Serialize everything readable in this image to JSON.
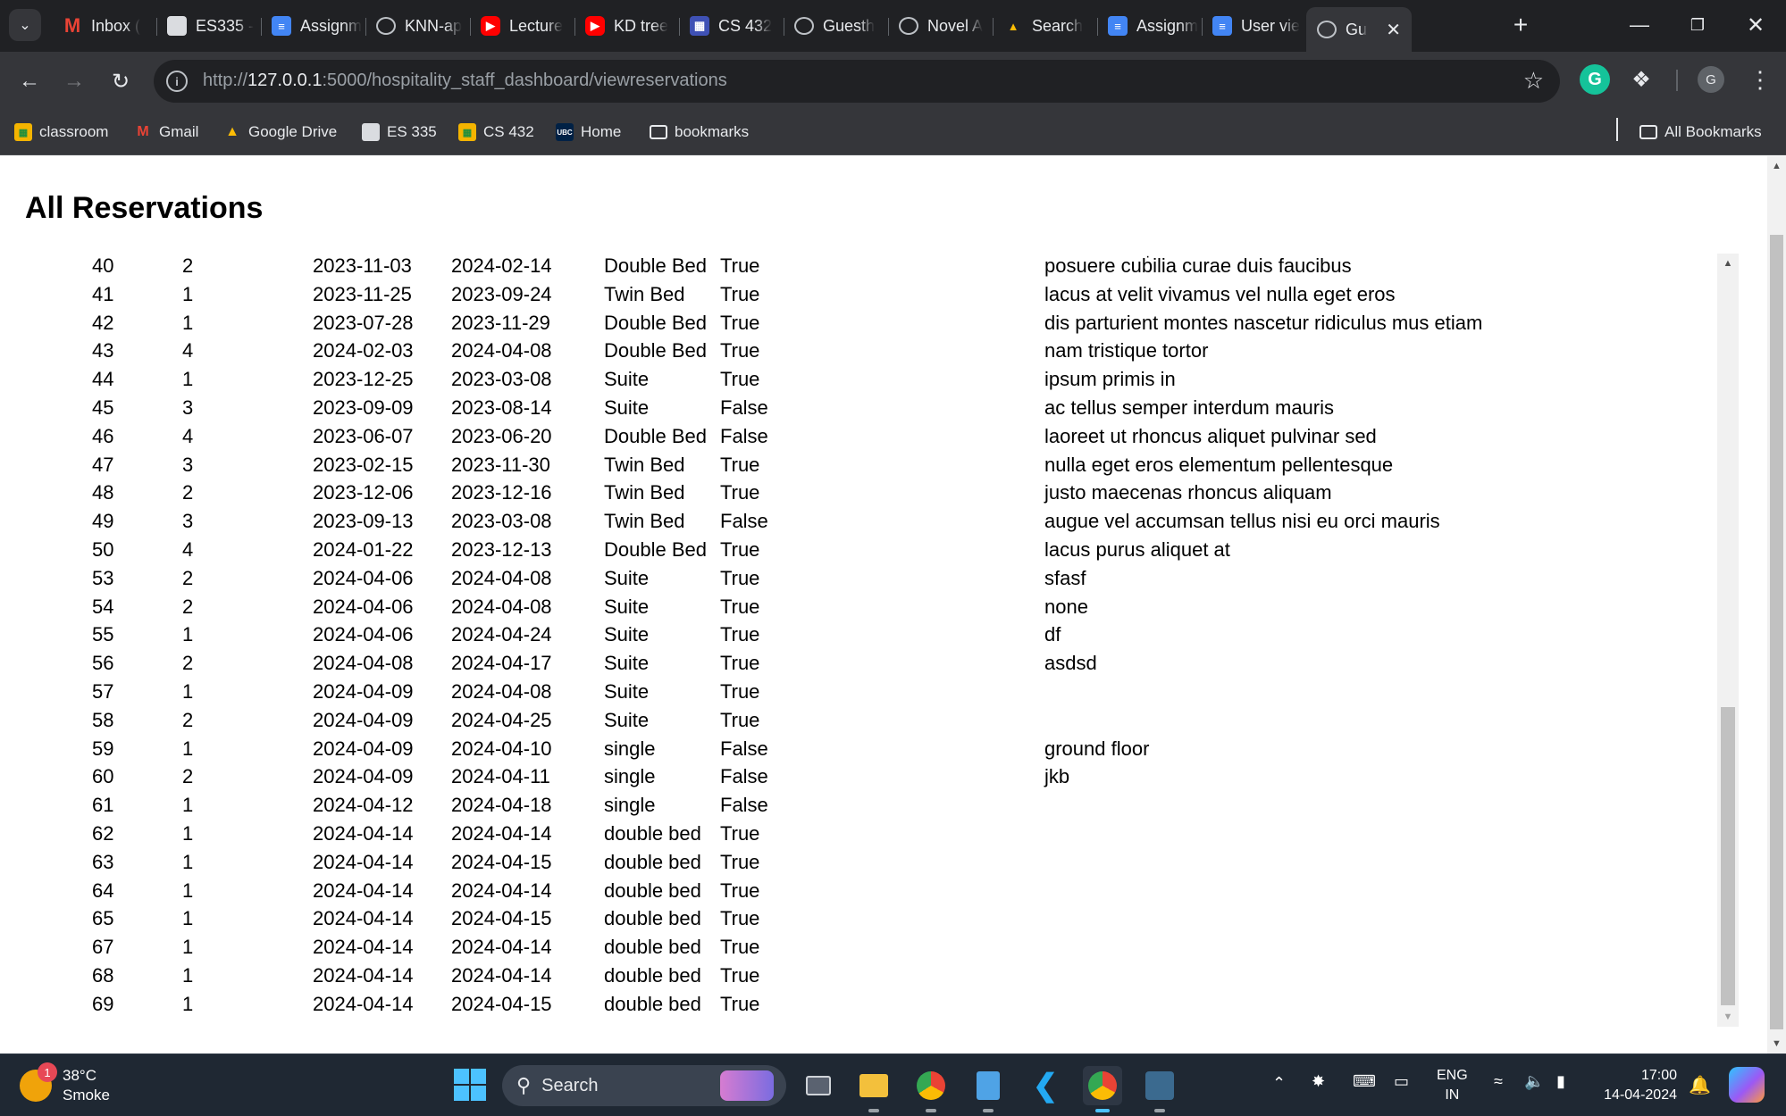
{
  "browser": {
    "tabs": [
      {
        "title": "Inbox (",
        "icon": "gmail-icon"
      },
      {
        "title": "ES335 -",
        "icon": "doc-image-icon"
      },
      {
        "title": "Assignm",
        "icon": "google-docs-icon"
      },
      {
        "title": "KNN-ap",
        "icon": "globe-icon"
      },
      {
        "title": "Lecture",
        "icon": "youtube-icon"
      },
      {
        "title": "KD tree",
        "icon": "youtube-icon"
      },
      {
        "title": "CS 432",
        "icon": "classroom-icon"
      },
      {
        "title": "Guesth",
        "icon": "globe-icon"
      },
      {
        "title": "Novel A",
        "icon": "globe-icon"
      },
      {
        "title": "Search",
        "icon": "google-drive-icon"
      },
      {
        "title": "Assignm",
        "icon": "google-docs-icon"
      },
      {
        "title": "User vie",
        "icon": "google-docs-icon"
      },
      {
        "title": "Gu",
        "icon": "globe-icon",
        "active": true
      }
    ],
    "url_prefix": "http://",
    "url_host": "127.0.0.1",
    "url_rest": ":5000/hospitality_staff_dashboard/viewreservations",
    "profile_initial": "G",
    "bookmarks": [
      {
        "label": "classroom",
        "icon": "classroom-icon"
      },
      {
        "label": "Gmail",
        "icon": "gmail-icon"
      },
      {
        "label": "Google Drive",
        "icon": "google-drive-icon"
      },
      {
        "label": "ES 335",
        "icon": "doc-image-icon"
      },
      {
        "label": "CS 432",
        "icon": "classroom-icon"
      },
      {
        "label": "Home",
        "icon": "ubc-icon"
      },
      {
        "label": "bookmarks",
        "icon": "folder-icon"
      }
    ],
    "all_bookmarks": "All Bookmarks"
  },
  "page": {
    "title": "All Reservations",
    "reservations": [
      {
        "id": "40",
        "guests": "2",
        "check_in": "2023-11-03",
        "check_out": "2024-02-14",
        "room": "Double Bed",
        "paid": "True",
        "notes": "posuere cubilia curae duis faucibus"
      },
      {
        "id": "41",
        "guests": "1",
        "check_in": "2023-11-25",
        "check_out": "2023-09-24",
        "room": "Twin Bed",
        "paid": "True",
        "notes": "lacus at velit vivamus vel nulla eget eros"
      },
      {
        "id": "42",
        "guests": "1",
        "check_in": "2023-07-28",
        "check_out": "2023-11-29",
        "room": "Double Bed",
        "paid": "True",
        "notes": "dis parturient montes nascetur ridiculus mus etiam"
      },
      {
        "id": "43",
        "guests": "4",
        "check_in": "2024-02-03",
        "check_out": "2024-04-08",
        "room": "Double Bed",
        "paid": "True",
        "notes": "nam tristique tortor"
      },
      {
        "id": "44",
        "guests": "1",
        "check_in": "2023-12-25",
        "check_out": "2023-03-08",
        "room": "Suite",
        "paid": "True",
        "notes": "ipsum primis in"
      },
      {
        "id": "45",
        "guests": "3",
        "check_in": "2023-09-09",
        "check_out": "2023-08-14",
        "room": "Suite",
        "paid": "False",
        "notes": "ac tellus semper interdum mauris"
      },
      {
        "id": "46",
        "guests": "4",
        "check_in": "2023-06-07",
        "check_out": "2023-06-20",
        "room": "Double Bed",
        "paid": "False",
        "notes": "laoreet ut rhoncus aliquet pulvinar sed"
      },
      {
        "id": "47",
        "guests": "3",
        "check_in": "2023-02-15",
        "check_out": "2023-11-30",
        "room": "Twin Bed",
        "paid": "True",
        "notes": "nulla eget eros elementum pellentesque"
      },
      {
        "id": "48",
        "guests": "2",
        "check_in": "2023-12-06",
        "check_out": "2023-12-16",
        "room": "Twin Bed",
        "paid": "True",
        "notes": "justo maecenas rhoncus aliquam"
      },
      {
        "id": "49",
        "guests": "3",
        "check_in": "2023-09-13",
        "check_out": "2023-03-08",
        "room": "Twin Bed",
        "paid": "False",
        "notes": "augue vel accumsan tellus nisi eu orci mauris"
      },
      {
        "id": "50",
        "guests": "4",
        "check_in": "2024-01-22",
        "check_out": "2023-12-13",
        "room": "Double Bed",
        "paid": "True",
        "notes": "lacus purus aliquet at"
      },
      {
        "id": "53",
        "guests": "2",
        "check_in": "2024-04-06",
        "check_out": "2024-04-08",
        "room": "Suite",
        "paid": "True",
        "notes": "sfasf"
      },
      {
        "id": "54",
        "guests": "2",
        "check_in": "2024-04-06",
        "check_out": "2024-04-08",
        "room": "Suite",
        "paid": "True",
        "notes": "none"
      },
      {
        "id": "55",
        "guests": "1",
        "check_in": "2024-04-06",
        "check_out": "2024-04-24",
        "room": "Suite",
        "paid": "True",
        "notes": "df"
      },
      {
        "id": "56",
        "guests": "2",
        "check_in": "2024-04-08",
        "check_out": "2024-04-17",
        "room": "Suite",
        "paid": "True",
        "notes": "asdsd"
      },
      {
        "id": "57",
        "guests": "1",
        "check_in": "2024-04-09",
        "check_out": "2024-04-08",
        "room": "Suite",
        "paid": "True",
        "notes": ""
      },
      {
        "id": "58",
        "guests": "2",
        "check_in": "2024-04-09",
        "check_out": "2024-04-25",
        "room": "Suite",
        "paid": "True",
        "notes": ""
      },
      {
        "id": "59",
        "guests": "1",
        "check_in": "2024-04-09",
        "check_out": "2024-04-10",
        "room": "single",
        "paid": "False",
        "notes": "ground floor"
      },
      {
        "id": "60",
        "guests": "2",
        "check_in": "2024-04-09",
        "check_out": "2024-04-11",
        "room": "single",
        "paid": "False",
        "notes": "jkb"
      },
      {
        "id": "61",
        "guests": "1",
        "check_in": "2024-04-12",
        "check_out": "2024-04-18",
        "room": "single",
        "paid": "False",
        "notes": ""
      },
      {
        "id": "62",
        "guests": "1",
        "check_in": "2024-04-14",
        "check_out": "2024-04-14",
        "room": "double bed",
        "paid": "True",
        "notes": ""
      },
      {
        "id": "63",
        "guests": "1",
        "check_in": "2024-04-14",
        "check_out": "2024-04-15",
        "room": "double bed",
        "paid": "True",
        "notes": ""
      },
      {
        "id": "64",
        "guests": "1",
        "check_in": "2024-04-14",
        "check_out": "2024-04-14",
        "room": "double bed",
        "paid": "True",
        "notes": ""
      },
      {
        "id": "65",
        "guests": "1",
        "check_in": "2024-04-14",
        "check_out": "2024-04-15",
        "room": "double bed",
        "paid": "True",
        "notes": ""
      },
      {
        "id": "67",
        "guests": "1",
        "check_in": "2024-04-14",
        "check_out": "2024-04-14",
        "room": "double bed",
        "paid": "True",
        "notes": ""
      },
      {
        "id": "68",
        "guests": "1",
        "check_in": "2024-04-14",
        "check_out": "2024-04-14",
        "room": "double bed",
        "paid": "True",
        "notes": ""
      },
      {
        "id": "69",
        "guests": "1",
        "check_in": "2024-04-14",
        "check_out": "2024-04-15",
        "room": "double bed",
        "paid": "True",
        "notes": ""
      }
    ]
  },
  "taskbar": {
    "weather_temp": "38°C",
    "weather_desc": "Smoke",
    "weather_badge": "1",
    "search_label": "Search",
    "language_top": "ENG",
    "language_bottom": "IN",
    "time": "17:00",
    "date": "14-04-2024"
  },
  "colors": {
    "tab_bar": "#202124",
    "toolbar": "#35363a",
    "taskbar": "#1f2833",
    "accent": "#4cc2ff"
  }
}
